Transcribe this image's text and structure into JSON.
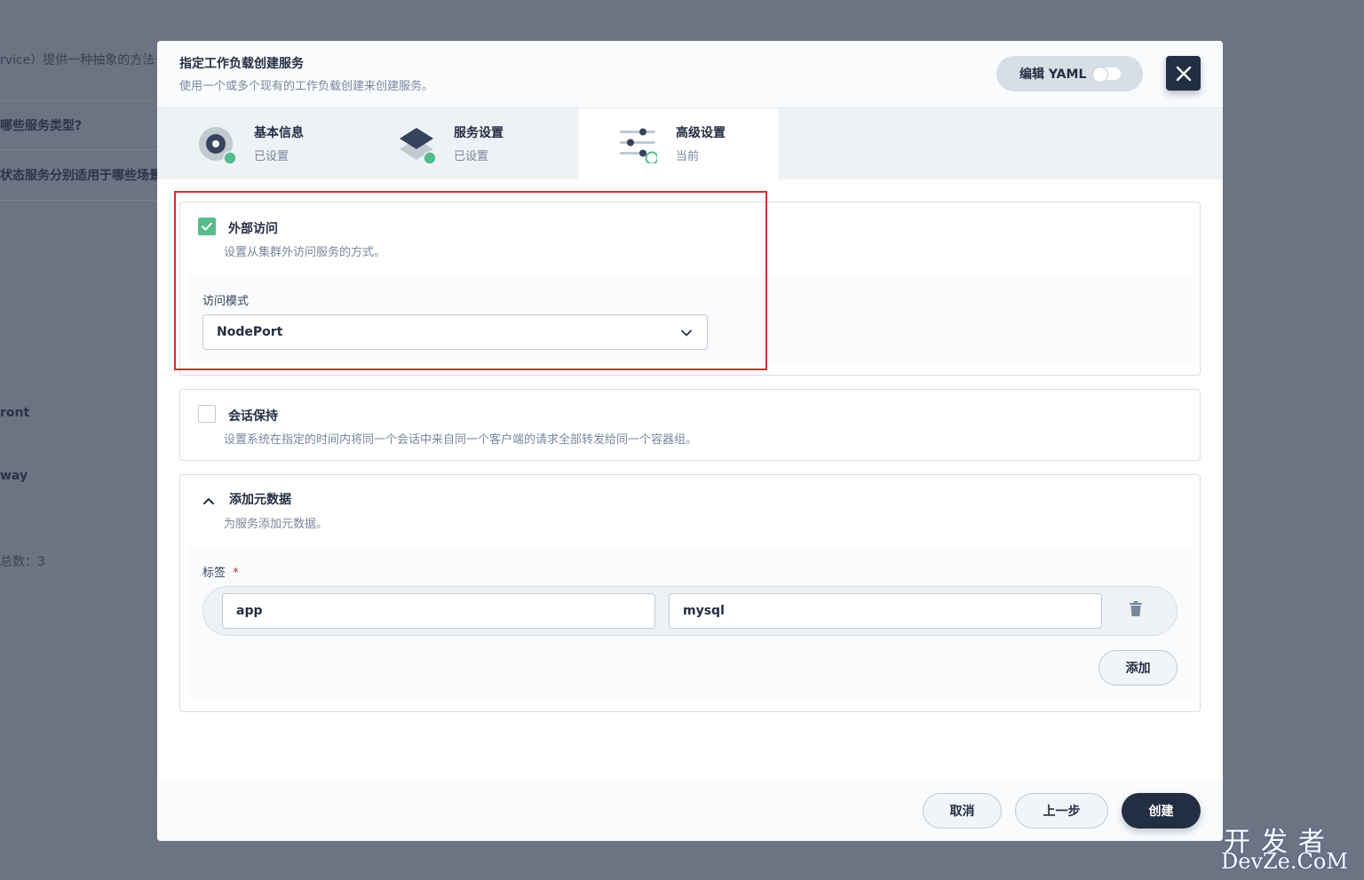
{
  "background": {
    "lines": [
      "rvice）提供一种抽象的方法",
      "哪些服务类型?",
      "状态服务分别适用于哪些场景",
      "ront",
      "way",
      "总数：3"
    ]
  },
  "modal": {
    "title": "指定工作负载创建服务",
    "description": "使用一个或多个现有的工作负载创建来创建服务。",
    "yaml_label": "编辑 YAML"
  },
  "steps": [
    {
      "title": "基本信息",
      "status": "已设置"
    },
    {
      "title": "服务设置",
      "status": "已设置"
    },
    {
      "title": "高级设置",
      "status": "当前"
    }
  ],
  "external_access": {
    "checked": true,
    "title": "外部访问",
    "description": "设置从集群外访问服务的方式。",
    "mode_label": "访问模式",
    "mode_value": "NodePort"
  },
  "session_affinity": {
    "checked": false,
    "title": "会话保持",
    "description": "设置系统在指定的时间内将同一个会话中来自同一个客户端的请求全部转发给同一个容器组。"
  },
  "metadata": {
    "title": "添加元数据",
    "description": "为服务添加元数据。",
    "labels_label": "标签",
    "required_mark": "*",
    "label_key": "app",
    "label_value": "mysql",
    "add_label": "添加"
  },
  "footer": {
    "cancel": "取消",
    "prev": "上一步",
    "create": "创建"
  },
  "watermark": {
    "line1": "开发者",
    "line2": "DevZe.CoM"
  },
  "colors": {
    "accent_green": "#55bc8a",
    "dark": "#242e42",
    "highlight_red": "#d32f2f"
  }
}
